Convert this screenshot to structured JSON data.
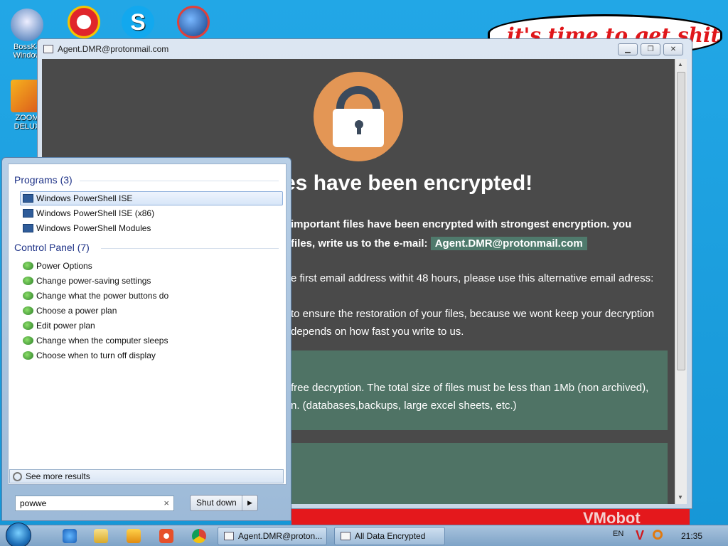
{
  "desktop": {
    "icons": [
      {
        "label": "BossKa Window",
        "icon": "bosskey-icon"
      },
      {
        "label": "",
        "icon": "p-app-icon"
      },
      {
        "label": "",
        "icon": "skype-icon"
      },
      {
        "label": "",
        "icon": "globe-app-icon"
      },
      {
        "label": "ZOOM DELUX",
        "icon": "zoom-deluxe-icon"
      }
    ],
    "wallpaper_bubble": "it's time to get shit",
    "wallpaper_banner": "VMobot"
  },
  "window": {
    "title": "Agent.DMR@protonmail.com",
    "heading": "es have been encrypted!",
    "lines": [
      "important files have been encrypted with strongest encryption. you",
      "files, write us to the e-mail:",
      "e first email address withit 48 hours, please use this alternative email adress:",
      "to ensure the restoration of your files, because we wont keep your decryption",
      "depends on how fast you write to us.",
      "free decryption. The total size of files must be less than 1Mb (non archived),",
      "n. (databases,backups, large excel sheets, etc.)"
    ],
    "email": "Agent.DMR@protonmail.com",
    "colors": {
      "background": "#4a4a4a",
      "lock_circle": "#e39655",
      "box": "#4f7365"
    }
  },
  "startmenu": {
    "programs_header": "Programs (3)",
    "programs": [
      "Windows PowerShell ISE",
      "Windows PowerShell ISE (x86)",
      "Windows PowerShell Modules"
    ],
    "control_panel_header": "Control Panel (7)",
    "control_panel": [
      "Power Options",
      "Change power-saving settings",
      "Change what the power buttons do",
      "Choose a power plan",
      "Edit power plan",
      "Change when the computer sleeps",
      "Choose when to turn off display"
    ],
    "see_more": "See more results",
    "search_value": "powwe",
    "shutdown_label": "Shut down"
  },
  "taskbar": {
    "tasks": [
      "Agent.DMR@proton...",
      "All Data Encrypted"
    ],
    "lang": "EN",
    "clock": "21:35"
  }
}
